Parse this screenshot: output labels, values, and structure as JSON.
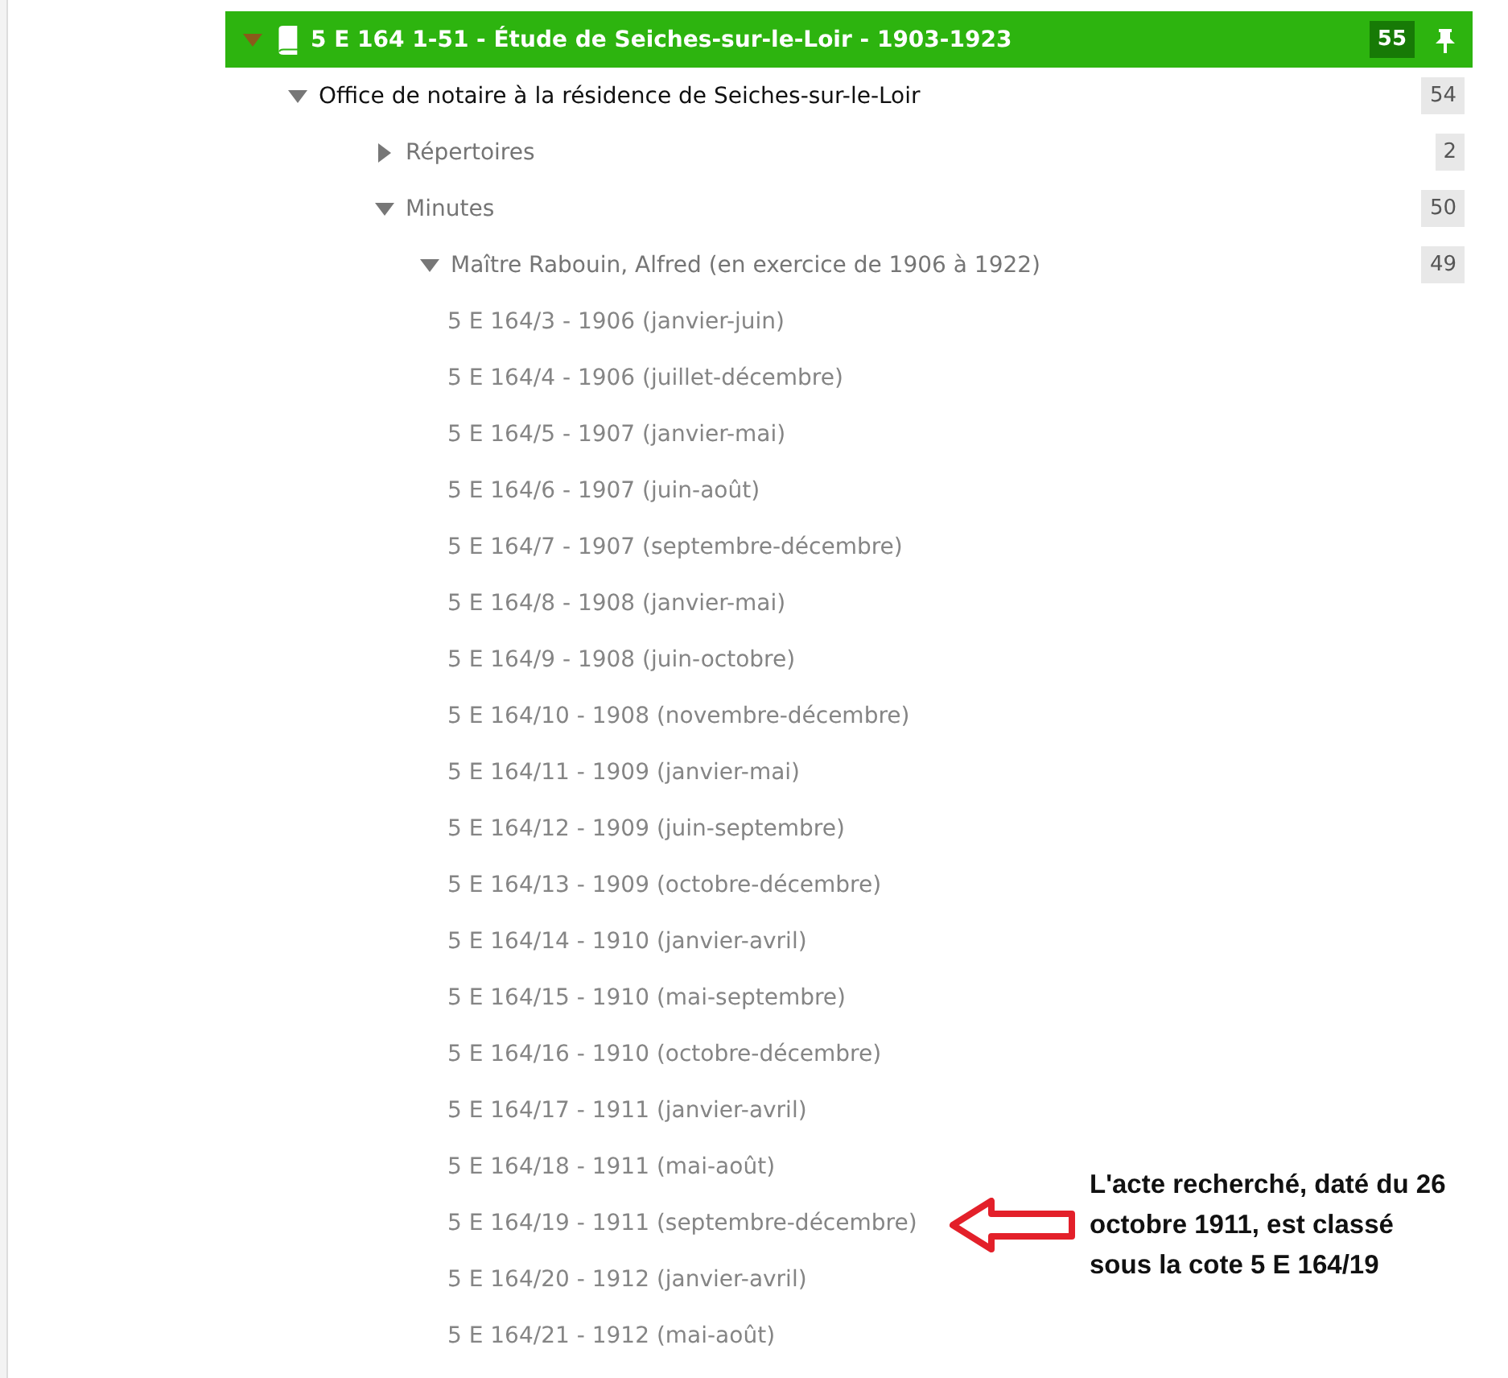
{
  "tree": [
    {
      "label": "5 E 164 1-51 - Étude de Seiches-sur-le-Loir - 1903-1923",
      "kind": "fonds",
      "count": "55",
      "expanded": true,
      "pinned": true,
      "children": [
        {
          "label": "Office de notaire à la résidence de Seiches-sur-le-Loir",
          "kind": "section",
          "count": "54",
          "expanded": true,
          "children": [
            {
              "label": "Répertoires",
              "kind": "series",
              "count": "2",
              "expanded": false
            },
            {
              "label": "Minutes",
              "kind": "series",
              "count": "50",
              "expanded": true,
              "children": [
                {
                  "label": "Maître Rabouin, Alfred (en exercice de 1906 à 1922)",
                  "kind": "series",
                  "count": "49",
                  "expanded": true,
                  "children": [
                    {
                      "label": "5 E 164/3 - 1906 (janvier-juin)",
                      "kind": "item"
                    },
                    {
                      "label": "5 E 164/4 - 1906 (juillet-décembre)",
                      "kind": "item"
                    },
                    {
                      "label": "5 E 164/5 - 1907 (janvier-mai)",
                      "kind": "item"
                    },
                    {
                      "label": "5 E 164/6 - 1907 (juin-août)",
                      "kind": "item"
                    },
                    {
                      "label": "5 E 164/7 - 1907 (septembre-décembre)",
                      "kind": "item"
                    },
                    {
                      "label": "5 E 164/8 - 1908 (janvier-mai)",
                      "kind": "item"
                    },
                    {
                      "label": "5 E 164/9 - 1908 (juin-octobre)",
                      "kind": "item"
                    },
                    {
                      "label": "5 E 164/10 - 1908 (novembre-décembre)",
                      "kind": "item"
                    },
                    {
                      "label": "5 E 164/11 - 1909 (janvier-mai)",
                      "kind": "item"
                    },
                    {
                      "label": "5 E 164/12 - 1909 (juin-septembre)",
                      "kind": "item"
                    },
                    {
                      "label": "5 E 164/13 - 1909 (octobre-décembre)",
                      "kind": "item"
                    },
                    {
                      "label": "5 E 164/14 - 1910 (janvier-avril)",
                      "kind": "item"
                    },
                    {
                      "label": "5 E 164/15 - 1910 (mai-septembre)",
                      "kind": "item"
                    },
                    {
                      "label": "5 E 164/16 - 1910 (octobre-décembre)",
                      "kind": "item"
                    },
                    {
                      "label": "5 E 164/17 - 1911 (janvier-avril)",
                      "kind": "item"
                    },
                    {
                      "label": "5 E 164/18 - 1911 (mai-août)",
                      "kind": "item"
                    },
                    {
                      "label": "5 E 164/19 - 1911 (septembre-décembre)",
                      "kind": "item"
                    },
                    {
                      "label": "5 E 164/20 - 1912 (janvier-avril)",
                      "kind": "item"
                    },
                    {
                      "label": "5 E 164/21 - 1912 (mai-août)",
                      "kind": "item"
                    }
                  ]
                }
              ]
            }
          ]
        }
      ]
    }
  ],
  "annotation": {
    "text": "L'acte recherché, daté du 26\noctobre 1911, est classé\nsous la cote 5 E 164/19"
  }
}
